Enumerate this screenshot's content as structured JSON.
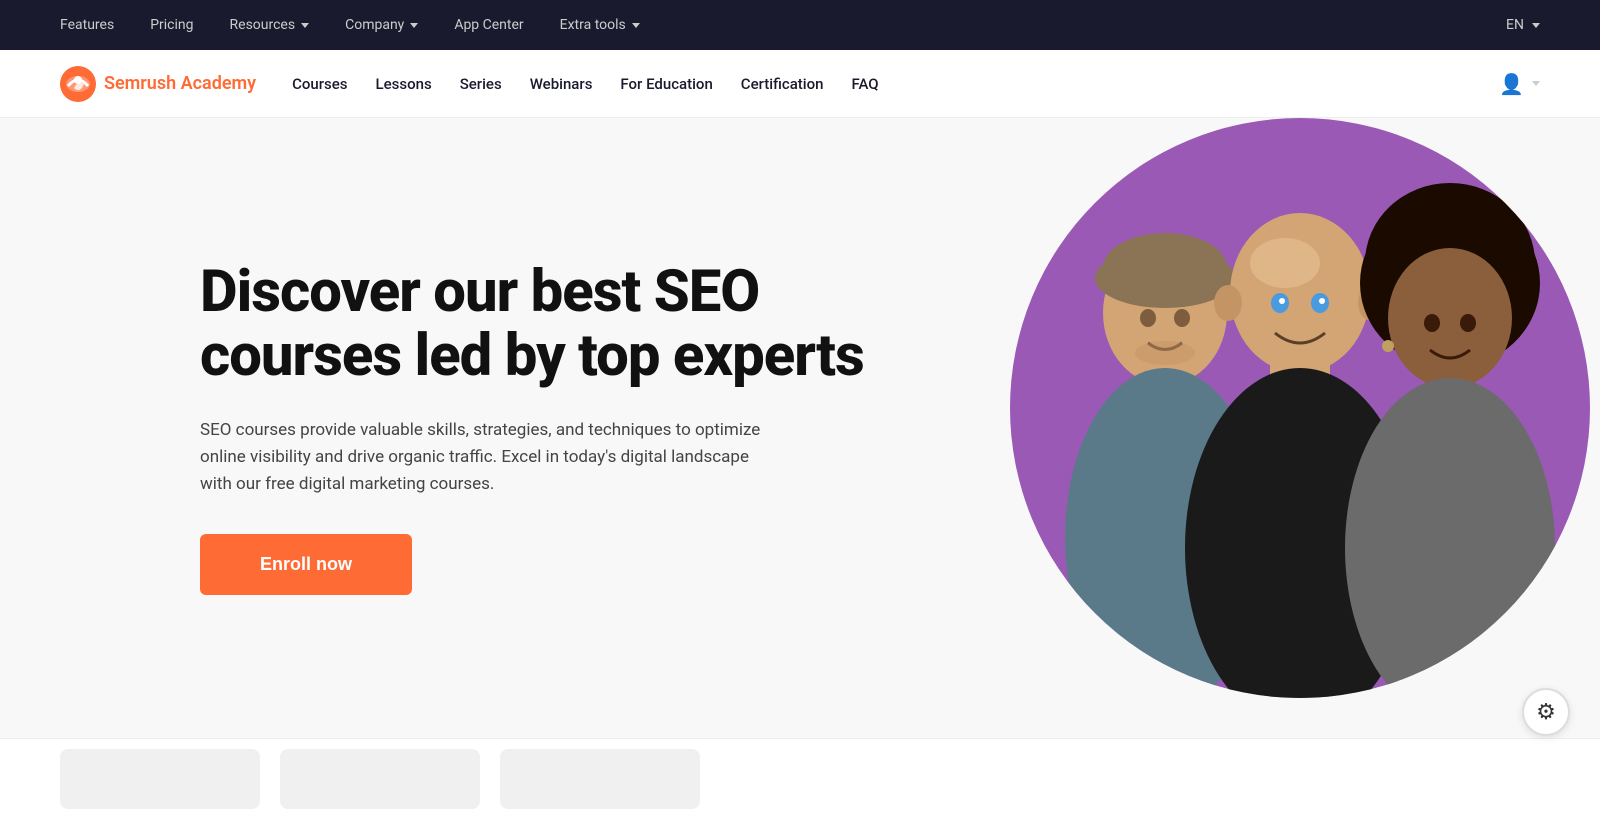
{
  "topbar": {
    "links": [
      {
        "label": "Features",
        "id": "features",
        "hasDropdown": false
      },
      {
        "label": "Pricing",
        "id": "pricing",
        "hasDropdown": false
      },
      {
        "label": "Resources",
        "id": "resources",
        "hasDropdown": true
      },
      {
        "label": "Company",
        "id": "company",
        "hasDropdown": true
      },
      {
        "label": "App Center",
        "id": "app-center",
        "hasDropdown": false
      },
      {
        "label": "Extra tools",
        "id": "extra-tools",
        "hasDropdown": true
      }
    ],
    "language": "EN"
  },
  "mainnav": {
    "logo_brand": "Semrush",
    "logo_accent": "Academy",
    "links": [
      {
        "label": "Courses",
        "id": "courses"
      },
      {
        "label": "Lessons",
        "id": "lessons"
      },
      {
        "label": "Series",
        "id": "series"
      },
      {
        "label": "Webinars",
        "id": "webinars"
      },
      {
        "label": "For Education",
        "id": "for-education"
      },
      {
        "label": "Certification",
        "id": "certification"
      },
      {
        "label": "FAQ",
        "id": "faq"
      }
    ]
  },
  "hero": {
    "title": "Discover our best SEO courses led by top experts",
    "description": "SEO courses provide valuable skills, strategies, and techniques to optimize online visibility and drive organic traffic. Excel in today's digital landscape with our free digital marketing courses.",
    "cta_label": "Enroll now",
    "bg_color": "#f8f8f8",
    "circle_color": "#9b59b6"
  },
  "gear": {
    "icon": "⚙"
  }
}
